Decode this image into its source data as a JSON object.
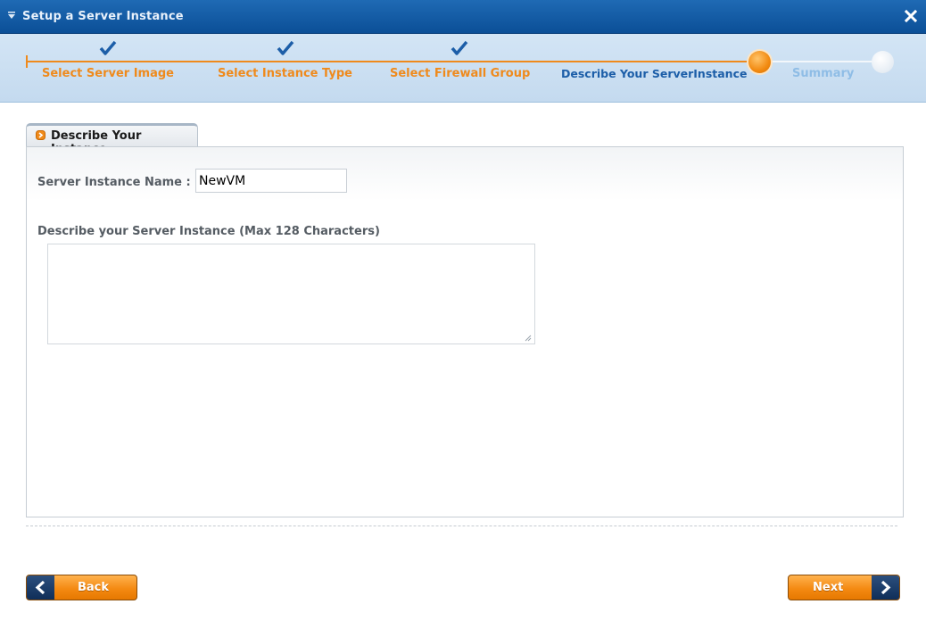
{
  "window": {
    "title": "Setup a Server Instance"
  },
  "steps": [
    {
      "label": "Select Server Image",
      "status": "done"
    },
    {
      "label": "Select Instance Type",
      "status": "done"
    },
    {
      "label": "Select Firewall Group",
      "status": "done"
    },
    {
      "label": "Describe Your ServerInstance",
      "status": "current"
    },
    {
      "label": "Summary",
      "status": "pending"
    }
  ],
  "tab": {
    "label": "Describe Your Instance"
  },
  "form": {
    "name_label": "Server Instance Name :",
    "name_value": "NewVM",
    "description_label": "Describe your Server Instance (Max 128 Characters)",
    "description_value": ""
  },
  "buttons": {
    "back_label": "Back",
    "next_label": "Next"
  },
  "colors": {
    "accent_orange": "#ef8a1c",
    "brand_blue": "#0b4f97",
    "current_step_text": "#1c5ea8",
    "pending_step_text": "#8fbde6"
  }
}
